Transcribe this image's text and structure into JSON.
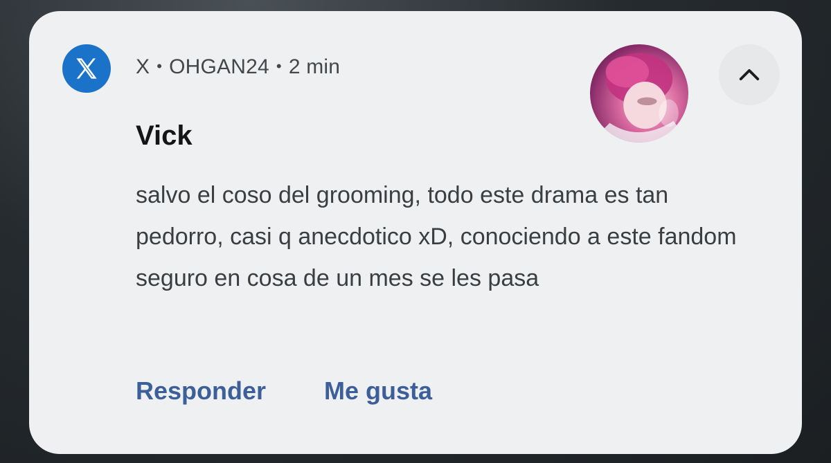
{
  "notification": {
    "app_name": "X",
    "separator": "•",
    "account": "OHGAN24",
    "time": "2 min",
    "sender": "Vick",
    "message": "salvo el coso del grooming, todo este drama es tan pedorro, casi q anecdotico xD, conociendo a este fandom seguro en cosa de un mes se les pasa",
    "app_icon": "x-logo-icon",
    "collapse_icon": "chevron-up-icon",
    "accent_color": "#1a73c8",
    "action_color": "#3d5f99"
  },
  "actions": {
    "reply_label": "Responder",
    "like_label": "Me gusta"
  }
}
